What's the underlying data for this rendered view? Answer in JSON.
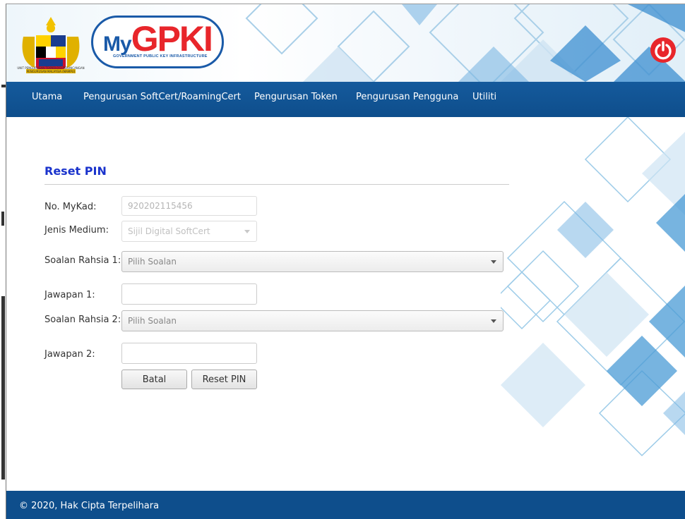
{
  "header": {
    "crest_caption": "UNIT PENGURUSAN TEKNOLOGI PERANCANGAN PENGURUSAN MALAYSIA (MAMPU)",
    "logo": {
      "prefix": "My",
      "brand": "GPKI",
      "subtitle": "GOVERNMENT PUBLIC KEY INFRASTRUCTURE"
    },
    "power_icon": "power-icon"
  },
  "nav": {
    "items": [
      {
        "label": "Utama"
      },
      {
        "label": "Pengurusan SoftCert/RoamingCert"
      },
      {
        "label": "Pengurusan Token"
      },
      {
        "label": "Pengurusan Pengguna"
      },
      {
        "label": "Utiliti"
      }
    ]
  },
  "form": {
    "title": "Reset PIN",
    "mykad": {
      "label": "No. MyKad:",
      "value": "920202115456"
    },
    "medium": {
      "label": "Jenis Medium:",
      "selected": "Sijil Digital SoftCert"
    },
    "q1": {
      "label": "Soalan Rahsia 1:",
      "selected": "Pilih Soalan"
    },
    "a1": {
      "label": "Jawapan 1:",
      "value": ""
    },
    "q2": {
      "label": "Soalan Rahsia 2:",
      "selected": "Pilih Soalan"
    },
    "a2": {
      "label": "Jawapan 2:",
      "value": ""
    },
    "cancel_label": "Batal",
    "submit_label": "Reset PIN"
  },
  "footer": {
    "copyright": "© 2020, Hak Cipta Terpelihara"
  },
  "colors": {
    "nav": "#0e4e8c",
    "accent": "#1a33cc",
    "power": "#e8262b",
    "logo_blue": "#1a5aa8"
  }
}
